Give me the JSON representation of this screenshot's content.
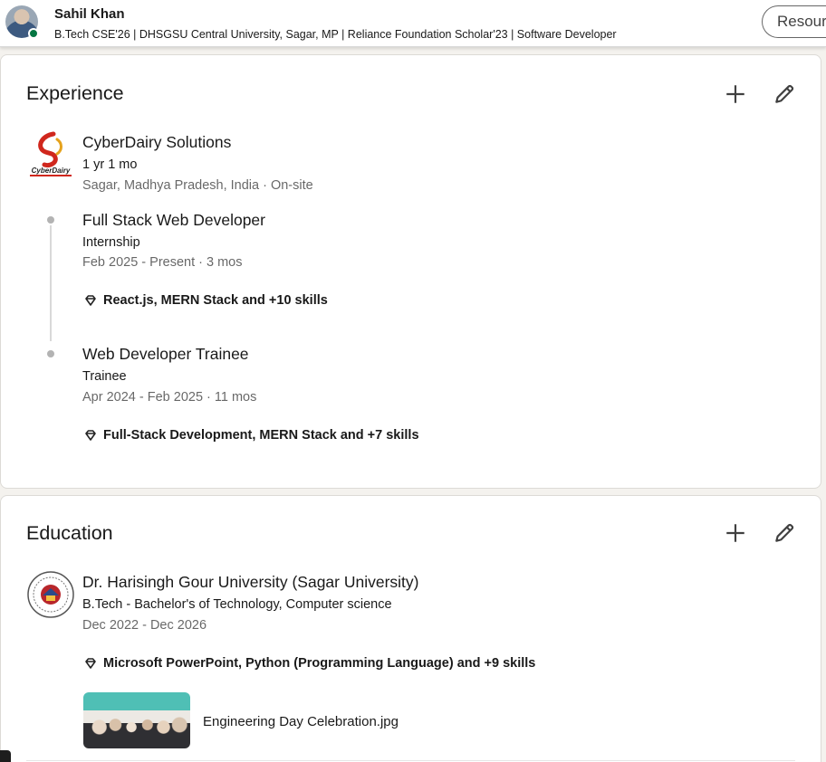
{
  "topbar": {
    "name": "Sahil Khan",
    "headline": "B.Tech CSE'26 | DHSGSU Central University, Sagar, MP | Reliance Foundation Scholar'23 | Software Developer",
    "resources_label": "Resources"
  },
  "experience": {
    "title": "Experience",
    "company": {
      "name": "CyberDairy Solutions",
      "logo_text": "CyberDairy",
      "duration": "1 yr 1 mo",
      "location": "Sagar, Madhya Pradesh, India · On-site"
    },
    "roles": [
      {
        "title": "Full Stack Web Developer",
        "type": "Internship",
        "dates": "Feb 2025 - Present · 3 mos",
        "skills": "React.js, MERN Stack and +10 skills"
      },
      {
        "title": "Web Developer Trainee",
        "type": "Trainee",
        "dates": "Apr 2024 - Feb 2025 · 11 mos",
        "skills": "Full-Stack Development, MERN Stack and +7 skills"
      }
    ]
  },
  "education": {
    "title": "Education",
    "school": "Dr. Harisingh Gour University (Sagar University)",
    "degree": "B.Tech - Bachelor's of Technology, Computer science",
    "dates": "Dec 2022 - Dec 2026",
    "skills": "Microsoft PowerPoint, Python (Programming Language) and +9 skills",
    "media_title": "Engineering Day Celebration.jpg"
  },
  "icons": {
    "add": "plus-icon",
    "edit": "pencil-icon",
    "skill": "diamond-icon"
  },
  "colors": {
    "page_bg": "#f4f2ee",
    "online": "#057642",
    "muted": "#666666"
  }
}
